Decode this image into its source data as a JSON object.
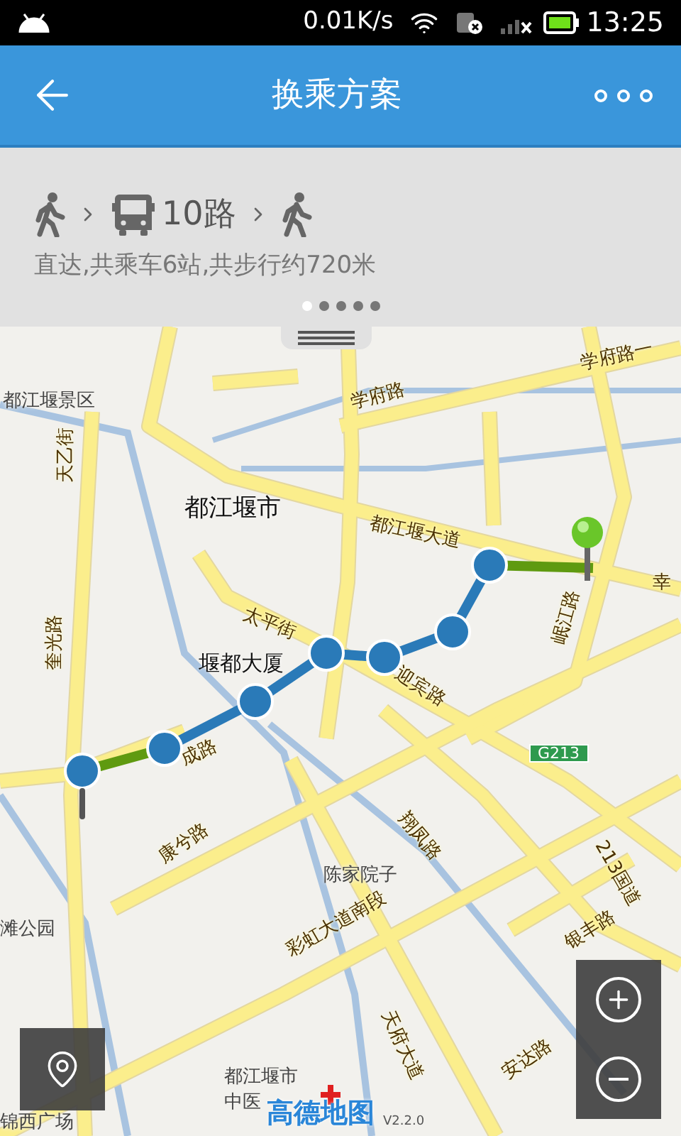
{
  "status_bar": {
    "network_speed": "0.01K/s",
    "time": "13:25"
  },
  "header": {
    "title": "换乘方案"
  },
  "route_summary": {
    "steps": [
      {
        "kind": "walk"
      },
      {
        "kind": "bus",
        "label": "10路"
      },
      {
        "kind": "walk"
      }
    ],
    "description": "直达,共乘车6站,共步行约720米",
    "pages": [
      {
        "selected": true
      },
      {
        "selected": false
      },
      {
        "selected": false
      },
      {
        "selected": false
      },
      {
        "selected": false
      }
    ]
  },
  "map": {
    "labels": [
      {
        "text": "都江堰景区",
        "kind": "place"
      },
      {
        "text": "学府路",
        "kind": "road"
      },
      {
        "text": "学府路一",
        "kind": "road"
      },
      {
        "text": "天乙街",
        "kind": "road"
      },
      {
        "text": "都江堰市",
        "kind": "city"
      },
      {
        "text": "都江堰大道",
        "kind": "road"
      },
      {
        "text": "太平街",
        "kind": "road"
      },
      {
        "text": "堰都大厦",
        "kind": "poi"
      },
      {
        "text": "迎宾路",
        "kind": "road"
      },
      {
        "text": "幸",
        "kind": "road"
      },
      {
        "text": "岷江路",
        "kind": "road"
      },
      {
        "text": "奎光路",
        "kind": "road"
      },
      {
        "text": "成路",
        "kind": "road"
      },
      {
        "text": "G213",
        "kind": "highway"
      },
      {
        "text": "翔凤路",
        "kind": "road"
      },
      {
        "text": "213国道",
        "kind": "road"
      },
      {
        "text": "康兮路",
        "kind": "road"
      },
      {
        "text": "陈家院子",
        "kind": "place"
      },
      {
        "text": "滩公园",
        "kind": "place"
      },
      {
        "text": "彩虹大道南段",
        "kind": "road"
      },
      {
        "text": "银丰路",
        "kind": "road"
      },
      {
        "text": "天府大道",
        "kind": "road"
      },
      {
        "text": "安达路",
        "kind": "road"
      },
      {
        "text": "都江堰市",
        "kind": "place"
      },
      {
        "text": "中医",
        "kind": "place"
      },
      {
        "text": "锦西广场",
        "kind": "place"
      }
    ],
    "logo": "高德地图",
    "version": "V2.2.0"
  }
}
